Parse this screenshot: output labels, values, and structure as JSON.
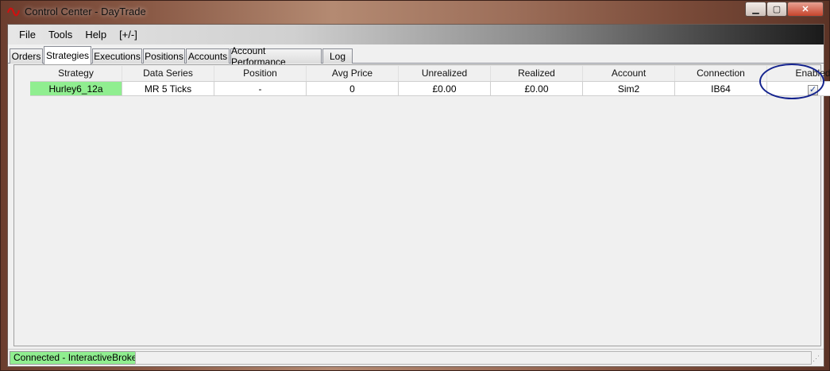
{
  "window": {
    "title": "Control Center - DayTrade",
    "controls": {
      "minimize": "▁",
      "maximize": "▢",
      "close": "✕"
    },
    "app_icon": "ninjatrader-wave-icon"
  },
  "menu": {
    "items": [
      "File",
      "Tools",
      "Help",
      "[+/-]"
    ]
  },
  "tabs": {
    "items": [
      "Orders",
      "Strategies",
      "Executions",
      "Positions",
      "Accounts",
      "Account Performance",
      "Log"
    ],
    "active": "Strategies"
  },
  "grid": {
    "columns": [
      "Strategy",
      "Data Series",
      "Position",
      "Avg Price",
      "Unrealized",
      "Realized",
      "Account",
      "Connection",
      "Enabled"
    ],
    "rows": [
      {
        "strategy": "Hurley6_12a",
        "data_series": "MR 5 Ticks",
        "position": "-",
        "avg_price": "0",
        "unrealized": "£0.00",
        "realized": "£0.00",
        "account": "Sim2",
        "connection": "IB64",
        "enabled": "✓"
      }
    ]
  },
  "status": {
    "connection": "Connected - InteractiveBrokers"
  },
  "colors": {
    "active_strategy": "#90ee90",
    "annotation": "#14238e"
  }
}
